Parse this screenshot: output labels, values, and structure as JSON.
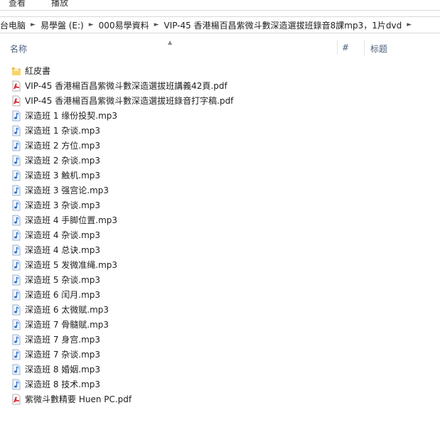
{
  "ribbon": {
    "tabs": [
      "查看",
      "播放"
    ]
  },
  "address": {
    "crumbs": [
      "台电脑",
      "易學盤 (E:)",
      "000易學資料",
      "VIP-45 香港楊百昌紫微斗數深造選拔班錄音8課mp3，1片dvd"
    ]
  },
  "columns": {
    "name": "名称",
    "number": "#",
    "title": "标题"
  },
  "files": [
    {
      "name": "紅皮書",
      "type": "folder"
    },
    {
      "name": "VIP-45 香港楊百昌紫微斗數深造選拔班講義42頁.pdf",
      "type": "pdf"
    },
    {
      "name": "VIP-45 香港楊百昌紫微斗數深造選拔班錄音打字稿.pdf",
      "type": "pdf"
    },
    {
      "name": "深造班 1 缘份投契.mp3",
      "type": "mp3"
    },
    {
      "name": "深造班 1 杂谈.mp3",
      "type": "mp3"
    },
    {
      "name": "深造班 2 方位.mp3",
      "type": "mp3"
    },
    {
      "name": "深造班 2 杂谈.mp3",
      "type": "mp3"
    },
    {
      "name": "深造班 3 触机.mp3",
      "type": "mp3"
    },
    {
      "name": "深造班 3 强宫论.mp3",
      "type": "mp3"
    },
    {
      "name": "深造班 3 杂谈.mp3",
      "type": "mp3"
    },
    {
      "name": "深造班 4 手脚位置.mp3",
      "type": "mp3"
    },
    {
      "name": "深造班 4 杂谈.mp3",
      "type": "mp3"
    },
    {
      "name": "深造班 4 总诀.mp3",
      "type": "mp3"
    },
    {
      "name": "深造班 5 发微准绳.mp3",
      "type": "mp3"
    },
    {
      "name": "深造班 5 杂谈.mp3",
      "type": "mp3"
    },
    {
      "name": "深造班 6 闰月.mp3",
      "type": "mp3"
    },
    {
      "name": "深造班 6 太微赋.mp3",
      "type": "mp3"
    },
    {
      "name": "深造班 7 骨髓赋.mp3",
      "type": "mp3"
    },
    {
      "name": "深造班 7 身宫.mp3",
      "type": "mp3"
    },
    {
      "name": "深造班 7 杂谈.mp3",
      "type": "mp3"
    },
    {
      "name": "深造班 8 婚姻.mp3",
      "type": "mp3"
    },
    {
      "name": "深造班 8 技术.mp3",
      "type": "mp3"
    },
    {
      "name": "紫微斗數精要 Huen PC.pdf",
      "type": "pdf"
    }
  ]
}
